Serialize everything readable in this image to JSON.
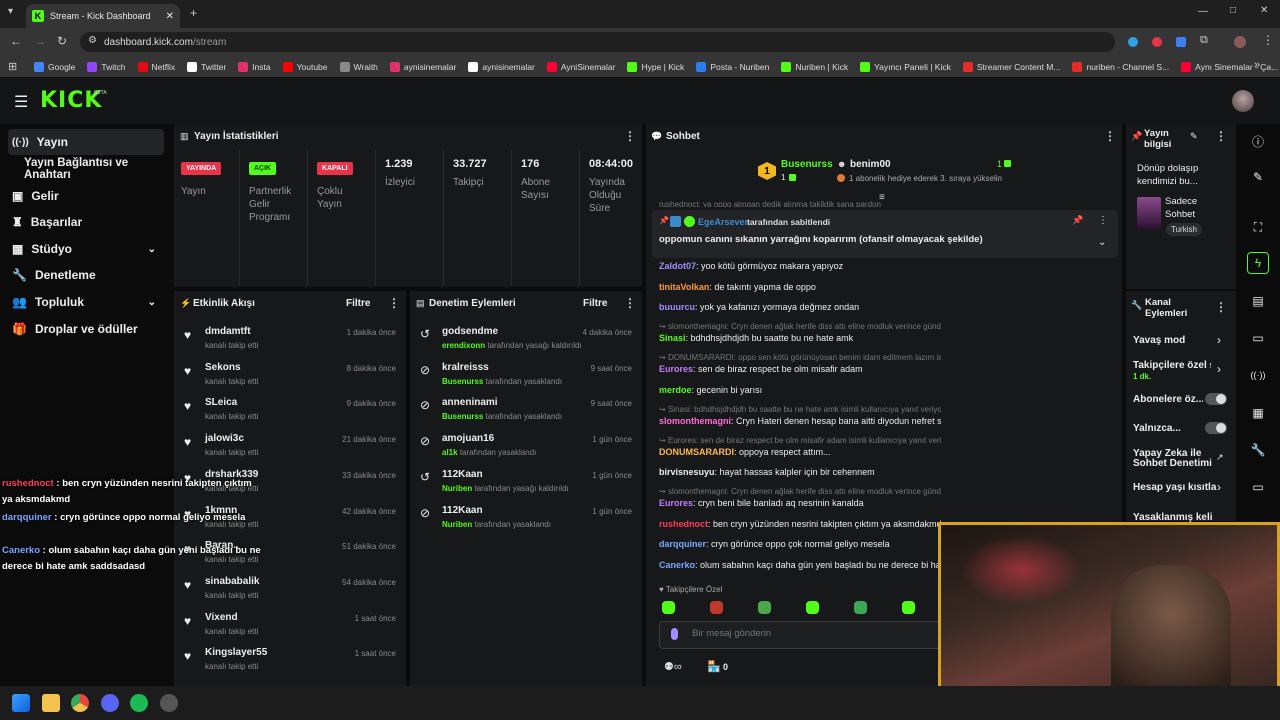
{
  "browser": {
    "tab_title": "Stream - Kick Dashboard",
    "url_host": "dashboard.kick.com",
    "url_path": "/stream",
    "bookmarks": [
      "Google",
      "Twitch",
      "Netflix",
      "Twitter",
      "Insta",
      "Youtube",
      "Wraith",
      "aynisinemalar",
      "aynisinemalar",
      "AyniSinemalar",
      "Hype | Kick",
      "Posta - Nuriben",
      "Nuriben | Kick",
      "Yayıncı Paneli | Kick",
      "Streamer Content M...",
      "nuriben - Channel S...",
      "Aynı Sinemalar - Ça..."
    ],
    "bookmark_colors": [
      "#4285f4",
      "#9146ff",
      "#e50914",
      "#ffffff",
      "#e1306c",
      "#ff0000",
      "#888888",
      "#e1306c",
      "#ffffff",
      "#ff0033",
      "#53fc18",
      "#2b7de9",
      "#53fc18",
      "#53fc18",
      "#e52d27",
      "#e52d27",
      "#ff0033"
    ]
  },
  "app": {
    "logo": "KICK",
    "beta": "BETA",
    "accent": "#53fc18"
  },
  "sidebar": {
    "items": [
      {
        "label": "Yayın",
        "icon": "broadcast-icon"
      },
      {
        "label": "Yayın Bağlantısı ve Anahtarı",
        "icon": ""
      },
      {
        "label": "Gelir",
        "icon": "wallet-icon"
      },
      {
        "label": "Başarılar",
        "icon": "trophy-icon"
      },
      {
        "label": "Stüdyo",
        "icon": "studio-icon"
      },
      {
        "label": "Denetleme",
        "icon": "wrench-icon"
      },
      {
        "label": "Topluluk",
        "icon": "people-icon"
      },
      {
        "label": "Droplar ve ödüller",
        "icon": "gift-icon"
      }
    ]
  },
  "stats": {
    "title": "Yayın İstatistikleri",
    "live_badge": "YAYINDA",
    "live_label": "Yayın",
    "partner_badge": "AÇIK",
    "partner_label": "Partnerlik Gelir Programı",
    "multi_badge": "KAPALI",
    "multi_label": "Çoklu Yayın",
    "viewers": "1.239",
    "viewers_label": "İzleyici",
    "followers": "33.727",
    "followers_label": "Takipçi",
    "subs": "176",
    "subs_label": "Abone Sayısı",
    "uptime": "08:44:00",
    "uptime_label": "Yayında Olduğu Süre"
  },
  "activity": {
    "title": "Etkinlik Akışı",
    "filter": "Filtre",
    "items": [
      {
        "name": "dmdamtft",
        "sub": "kanalı takip etti",
        "time": "1 dakika önce"
      },
      {
        "name": "Sekons",
        "sub": "kanalı takip etti",
        "time": "8 dakika önce"
      },
      {
        "name": "SLeica",
        "sub": "kanalı takip etti",
        "time": "9 dakika önce"
      },
      {
        "name": "jalowi3c",
        "sub": "kanalı takip etti",
        "time": "21 dakika önce"
      },
      {
        "name": "drshark339",
        "sub": "kanalı takip etti",
        "time": "33 dakika önce"
      },
      {
        "name": "1kmnn",
        "sub": "kanalı takip etti",
        "time": "42 dakika önce"
      },
      {
        "name": "Baran..",
        "sub": "kanalı takip etti",
        "time": "51 dakika önce"
      },
      {
        "name": "sinababalik",
        "sub": "kanalı takip etti",
        "time": "54 dakika önce"
      },
      {
        "name": "Vixend",
        "sub": "kanalı takip etti",
        "time": "1 saat önce"
      },
      {
        "name": "Kingslayer55",
        "sub": "kanalı takip etti",
        "time": "1 saat önce"
      }
    ]
  },
  "moderation": {
    "title": "Denetim Eylemleri",
    "filter": "Filtre",
    "items": [
      {
        "name": "godsendme",
        "mod": "erendixonn",
        "action": "tarafından yasağı kaldırıldı",
        "time": "4 dakika önce",
        "icon": "undo-icon"
      },
      {
        "name": "kralreisss",
        "mod": "Busenurss",
        "action": "tarafından yasaklandı",
        "time": "9 saat önce",
        "icon": "ban-icon"
      },
      {
        "name": "anneninami",
        "mod": "Busenurss",
        "action": "tarafından yasaklandı",
        "time": "9 saat önce",
        "icon": "ban-icon"
      },
      {
        "name": "amojuan16",
        "mod": "al1k",
        "action": "tarafından yasaklandı",
        "time": "1 gün önce",
        "icon": "ban-icon"
      },
      {
        "name": "112Kaan",
        "mod": "Nuriben",
        "action": "tarafından yasağı kaldırıldı",
        "time": "1 gün önce",
        "icon": "undo-icon"
      },
      {
        "name": "112Kaan",
        "mod": "Nuriben",
        "action": "tarafından yasaklandı",
        "time": "1 gün önce",
        "icon": "ban-icon"
      }
    ]
  },
  "chat": {
    "title": "Sohbet",
    "gift_user": "Busenurss",
    "gift_count": "1",
    "gift_sub": "1",
    "gift2_user": "benim00",
    "gift2_count": "1",
    "gift_notice": "1 abonelik hediye ederek 3. sıraya yükselin",
    "partial_top": "rushednoct: ya oppo alıngan dedik alınma takildik sana pardon",
    "pinned_by": "EgeArseven",
    "pinned_by_suffix": "tarafından sabitlendi",
    "pinned_msg": "oppomun canını sıkanın yarrağını koparırım (ofansif olmayacak şekilde)",
    "messages": [
      {
        "type": "msg",
        "user": "Zaldot07",
        "color": "#a48cff",
        "text": "yoo kötü görmüyoz makara yapıyoz"
      },
      {
        "type": "msg",
        "user": "tinitaVolkan",
        "color": "#ff9a3c",
        "text": "de takıntı yapma de oppo"
      },
      {
        "type": "msg",
        "user": "buuurcu",
        "color": "#a48cff",
        "text": "yok ya kafanızı yormaya değmez ondan"
      },
      {
        "type": "reply",
        "text": "slomonthemagni: Cryn denen ağlak herife diss attı eline modluk verince günde 100 kişiyi banlıyo şımarık alıngan ..."
      },
      {
        "type": "msg",
        "user": "Sinasi",
        "color": "#53fc18",
        "text": "bdhdhsjdhdjdh bu saatte bu ne hate amk"
      },
      {
        "type": "reply",
        "text": "DONUMSARARDI: oppo sen kötü görünüyosan benim idam edilmem lazım isimli kullanıcıya yanıt veriyor"
      },
      {
        "type": "msg",
        "user": "Eurores",
        "color": "#c57bff",
        "text": "sen de biraz respect be olm misafir adam"
      },
      {
        "type": "msg",
        "user": "merdoe",
        "color": "#53fc18",
        "text": "gecenin bi yarısı"
      },
      {
        "type": "reply",
        "text": "Sinasi: bdhdhsjdhdjdh bu saatte bu ne hate amk isimli kullanıcıya yanıt veriyor"
      },
      {
        "type": "msg",
        "user": "slomonthemagni",
        "color": "#ff6bd6",
        "text": "Cryn Hateri denen hesap bana aitti diyodun nefret seviyesini"
      },
      {
        "type": "reply",
        "text": "Eurores: sen de biraz respect be olm misafir adam isimli kullanıcıya yanıt veriyor"
      },
      {
        "type": "msg",
        "user": "DONUMSARARDI",
        "color": "#ffb84d",
        "text": "oppoya respect attım..."
      },
      {
        "type": "msg",
        "user": "birvisnesuyu",
        "color": "#eeeeee",
        "text": "hayat hassas kalpler için bir cehennem"
      },
      {
        "type": "reply",
        "text": "slomonthemagni: Cryn denen ağlak herife diss attı eline modluk verince günde 100 kişiyi banlıyo şımarık alıngan ..."
      },
      {
        "type": "msg",
        "user": "Eurores",
        "color": "#c57bff",
        "text": "cryn beni bile banladı aq nesrinin kanalda"
      },
      {
        "type": "msg",
        "user": "rushednoct",
        "color": "#ff3b5c",
        "text": "ben cryn yüzünden nesrini takipten çıktım ya aksmdakmd"
      },
      {
        "type": "msg",
        "user": "darqquiner",
        "color": "#7aa7ff",
        "text": "cryn görünce oppo çok normal geliyo mesela"
      },
      {
        "type": "msg",
        "user": "Canerko",
        "color": "#7aa7ff",
        "text": "olum sabahın kaçı daha gün yeni başladı bu ne derece bi hate amk saddsadasd"
      }
    ],
    "followers_only": "Takipçilere Özel",
    "input_placeholder": "Bir mesaj gönderin",
    "points": "0"
  },
  "stream_info": {
    "title": "Yayın bilgisi",
    "stream_title": "Dönüp dolaşıp kendimizi bu...",
    "category": "Sadece Sohbet",
    "language": "Turkish"
  },
  "channel_actions": {
    "title": "Kanal Eylemleri",
    "slow_mode": "Yavaş mod",
    "followers_only": "Takipçilere özel s...",
    "followers_only_value": "1 dk.",
    "subs_only": "Abonelere öz...",
    "emotes_only": "Yalnızca...",
    "ai_moderation": "Yapay Zeka ile Sohbet Denetimi",
    "age_restrict": "Hesap yaşı kısıtla",
    "banned_words": "Yasaklanmış kelim..."
  },
  "overlay": [
    {
      "user": "rushednoct",
      "color": "#ff3b5c",
      "text": "ben cryn yüzünden nesrini takipten çıktım ya aksmdakmd"
    },
    {
      "user": "darqquiner",
      "color": "#7aa7ff",
      "text": "cryn görünce oppo normal geliyo mesela"
    },
    {
      "user": "Canerko",
      "color": "#7aa7ff",
      "text": "olum sabahın kaçı daha gün yeni başladı bu ne derece bi hate amk saddsadasd"
    }
  ]
}
